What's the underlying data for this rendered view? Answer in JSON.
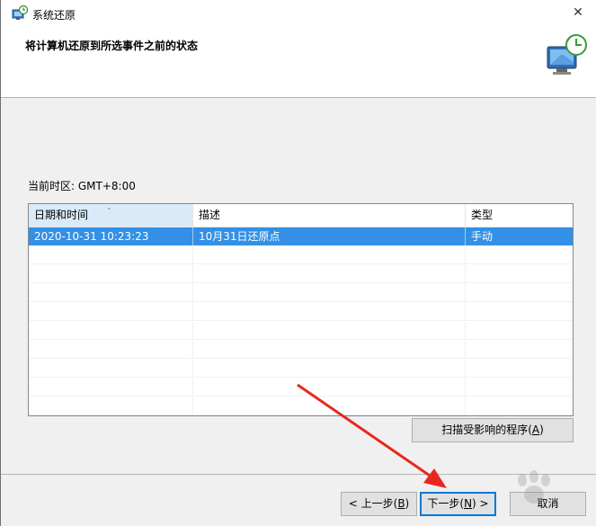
{
  "window": {
    "title": "系统还原",
    "close_glyph": "✕"
  },
  "header": {
    "title": "将计算机还原到所选事件之前的状态"
  },
  "timezone_label": "当前时区: GMT+8:00",
  "table": {
    "columns": [
      "日期和时间",
      "描述",
      "类型"
    ],
    "rows": [
      {
        "date": "2020-10-31 10:23:23",
        "description": "10月31日还原点",
        "type": "手动"
      }
    ]
  },
  "buttons": {
    "scan": {
      "text": "扫描受影响的程序(",
      "key": "A",
      "tail": ")"
    },
    "prev": {
      "text": "< 上一步(",
      "key": "B",
      "tail": ")"
    },
    "next": {
      "text": "下一步(",
      "key": "N",
      "tail": ") >"
    },
    "cancel": "取消"
  },
  "colors": {
    "selection": "#3390e6",
    "annotation_arrow": "#e8281e",
    "focus_border": "#0078d7"
  },
  "icons": {
    "title": "system-restore-icon",
    "header": "restore-computer-icon",
    "close": "close-icon"
  }
}
